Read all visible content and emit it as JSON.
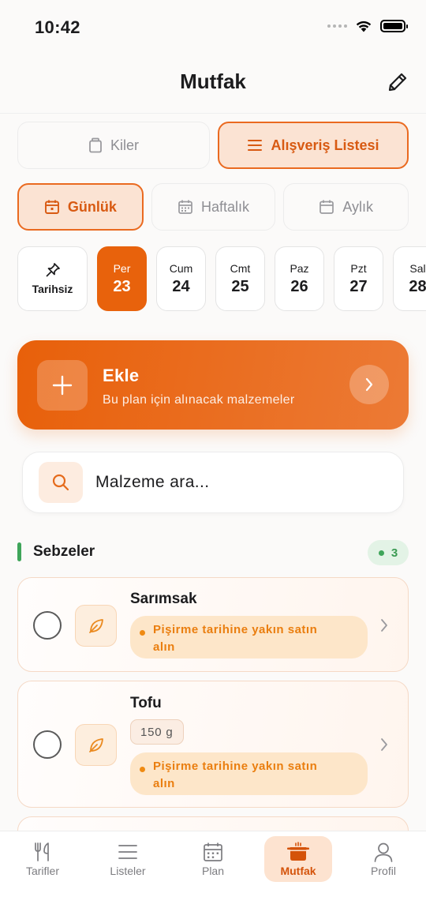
{
  "status_bar": {
    "time": "10:42"
  },
  "header": {
    "title": "Mutfak",
    "edit_icon": "pencil-icon"
  },
  "main_tabs": [
    {
      "label": "Kiler",
      "icon": "jar-icon",
      "active": false
    },
    {
      "label": "Alışveriş Listesi",
      "icon": "list-icon",
      "active": true
    }
  ],
  "period_tabs": [
    {
      "label": "Günlük",
      "icon": "calendar-day-icon",
      "active": true
    },
    {
      "label": "Haftalık",
      "icon": "calendar-week-icon",
      "active": false
    },
    {
      "label": "Aylık",
      "icon": "calendar-month-icon",
      "active": false
    }
  ],
  "dates": {
    "undated_label": "Tarihsiz",
    "days": [
      {
        "dow": "Per",
        "day": "23",
        "active": true
      },
      {
        "dow": "Cum",
        "day": "24",
        "active": false
      },
      {
        "dow": "Cmt",
        "day": "25",
        "active": false
      },
      {
        "dow": "Paz",
        "day": "26",
        "active": false
      },
      {
        "dow": "Pzt",
        "day": "27",
        "active": false
      },
      {
        "dow": "Sal",
        "day": "28",
        "active": false
      }
    ]
  },
  "add_banner": {
    "title": "Ekle",
    "subtitle": "Bu plan için alınacak malzemeler"
  },
  "search": {
    "placeholder": "Malzeme ara..."
  },
  "section": {
    "title": "Sebzeler",
    "count": "3",
    "accent": "#3fa55a"
  },
  "items": [
    {
      "name": "Sarımsak",
      "tip_line1": "Pişirme tarihine yakın satın",
      "tip_line2": "alın",
      "icon": "leaf-icon"
    },
    {
      "name": "Tofu",
      "qty": "150 g",
      "tip_line1": "Pişirme tarihine yakın satın",
      "tip_line2": "alın",
      "icon": "leaf-icon"
    }
  ],
  "tab_bar": [
    {
      "label": "Tarifler",
      "icon": "fork-knife-icon",
      "active": false
    },
    {
      "label": "Listeler",
      "icon": "list-lines-icon",
      "active": false
    },
    {
      "label": "Plan",
      "icon": "calendar-icon",
      "active": false
    },
    {
      "label": "Mutfak",
      "icon": "pot-icon",
      "active": true
    },
    {
      "label": "Profil",
      "icon": "person-icon",
      "active": false
    }
  ],
  "colors": {
    "accent": "#e8620c",
    "accent_light": "#fbe3d3",
    "tip_text": "#ea7e0f"
  }
}
